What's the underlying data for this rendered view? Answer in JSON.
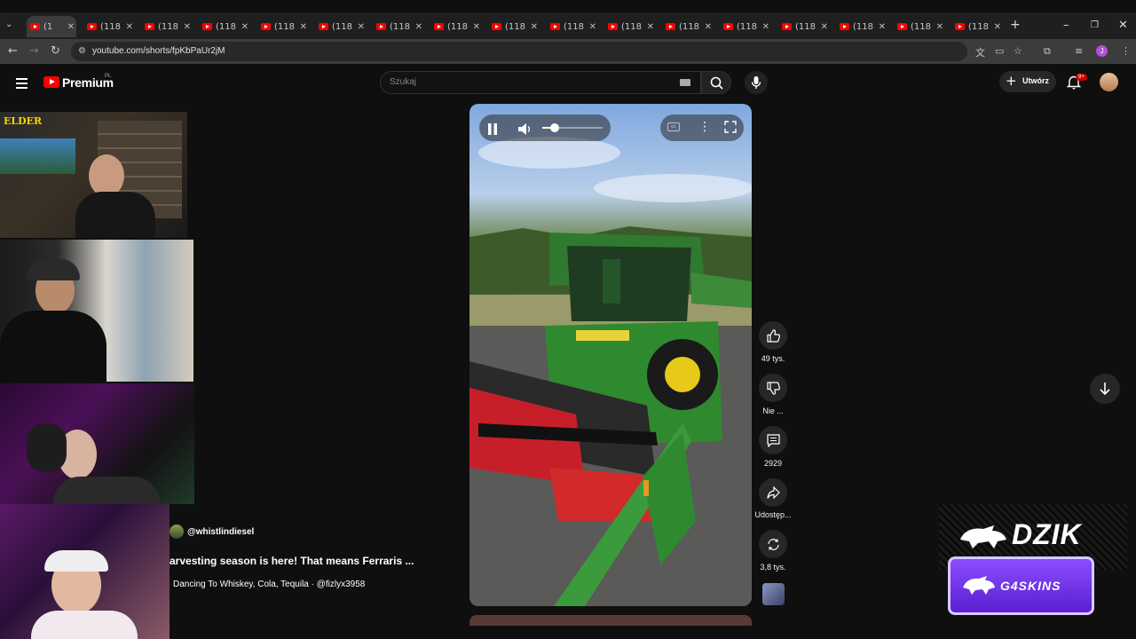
{
  "browser": {
    "tabs": [
      {
        "label": "(1"
      },
      {
        "label": "(118"
      },
      {
        "label": "(118"
      },
      {
        "label": "(118"
      },
      {
        "label": "(118"
      },
      {
        "label": "(118"
      },
      {
        "label": "(118"
      },
      {
        "label": "(118"
      },
      {
        "label": "(118"
      },
      {
        "label": "(118"
      },
      {
        "label": "(118"
      },
      {
        "label": "(118"
      },
      {
        "label": "(118"
      },
      {
        "label": "(118"
      },
      {
        "label": "(118"
      },
      {
        "label": "(118"
      },
      {
        "label": "(118"
      }
    ],
    "url": "youtube.com/shorts/fpKbPaUr2jM"
  },
  "masthead": {
    "brand": "Premium",
    "brand_region": "PL",
    "search_placeholder": "Szukaj",
    "create_label": "Utwórz",
    "notification_count": "9+"
  },
  "overlay": {
    "webcam_label": "ELDER",
    "sponsor": "DZIK",
    "sponsor_badge": "G4SKINS"
  },
  "short": {
    "channel": "@whistlindiesel",
    "title": "arvesting season is here! That means Ferraris ...",
    "audio": "Dancing To Whiskey, Cola, Tequila · @fizlyx3958",
    "volume_fraction": 0.2
  },
  "actions": {
    "likes": "49 tys.",
    "dislike": "Nie ...",
    "comments": "2929",
    "share": "Udostęp...",
    "remix": "3,8 tys."
  },
  "colors": {
    "accent": "#ff0000",
    "background": "#0f0f0f",
    "sponsor_purple": "#6a2ee0"
  }
}
